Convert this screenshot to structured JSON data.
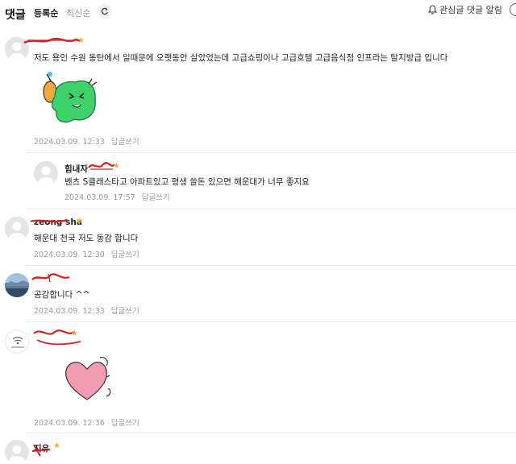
{
  "header": {
    "title": "댓글",
    "sort_registered": "등록순",
    "sort_latest": "최신순",
    "alarm_label": "관심글 댓글 알림"
  },
  "comments": [
    {
      "nickname": "",
      "text": "저도 용인 수원 동탄에서 일때문에 오랫동안 살았었는데 고급쇼핑이나 고급호텔 고급음식점 인프라는 탈지방급 입니다",
      "date": "2024.03.09. 12:33",
      "reply": "답글쓰기",
      "sticker": "green-character-sticker"
    },
    {
      "nickname": "힘내자 ",
      "text": "벤츠 S클래스타고 아파트있고 평생 쓸돈 있으면 해운대가 너무 좋지요",
      "date": "2024.03.09. 17:57",
      "reply": "답글쓰기"
    },
    {
      "nickname": "zeong sha",
      "text": "해운대 천국 저도 동감 합니다",
      "date": "2024.03.09. 12:30",
      "reply": "답글쓰기"
    },
    {
      "nickname": "",
      "text": "공감합니다 ^^",
      "date": "2024.03.09. 12:33",
      "reply": "답글쓰기"
    },
    {
      "nickname": "",
      "text": "",
      "date": "2024.03.09. 12:36",
      "reply": "답글쓰기",
      "sticker": "heart-sticker"
    },
    {
      "nickname": "지유",
      "text": "",
      "date": "",
      "reply": ""
    }
  ],
  "colors": {
    "star": "#e0b63a",
    "scribble": "#d62020",
    "meta": "#999999",
    "divider": "#ececec"
  }
}
